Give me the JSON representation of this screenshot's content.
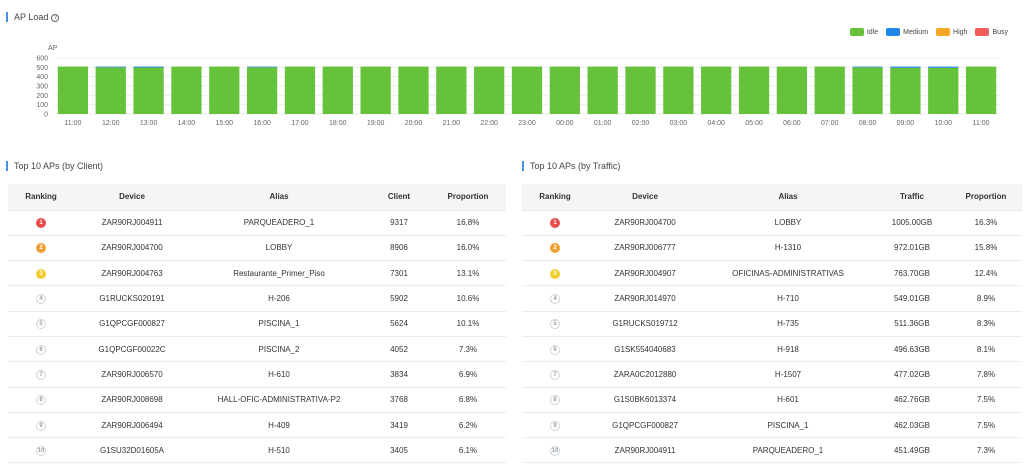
{
  "ap_load": {
    "title": "AP Load",
    "help_icon": "question-circle-icon",
    "legend": [
      {
        "label": "Idle",
        "color": "#66c23a"
      },
      {
        "label": "Medium",
        "color": "#1e88e5"
      },
      {
        "label": "High",
        "color": "#f5a623"
      },
      {
        "label": "Busy",
        "color": "#f25c5c"
      }
    ]
  },
  "chart_data": {
    "type": "bar",
    "stacked": true,
    "ylabel": "AP",
    "ylim": [
      0,
      600
    ],
    "yticks": [
      0,
      100,
      200,
      300,
      400,
      500,
      600
    ],
    "categories": [
      "11:00",
      "12:00",
      "13:00",
      "14:00",
      "15:00",
      "16:00",
      "17:00",
      "18:00",
      "19:00",
      "20:00",
      "21:00",
      "22:00",
      "23:00",
      "00:00",
      "01:00",
      "02:00",
      "03:00",
      "04:00",
      "05:00",
      "06:00",
      "07:00",
      "08:00",
      "09:00",
      "10:00",
      "11:00"
    ],
    "series": [
      {
        "name": "Idle",
        "color": "#66c23a",
        "values": [
          508,
          500,
          498,
          508,
          508,
          500,
          508,
          508,
          508,
          508,
          508,
          508,
          508,
          508,
          508,
          508,
          508,
          508,
          508,
          508,
          508,
          500,
          495,
          495,
          508
        ]
      },
      {
        "name": "Medium",
        "color": "#1e88e5",
        "values": [
          0,
          8,
          10,
          0,
          0,
          8,
          0,
          0,
          0,
          0,
          0,
          0,
          0,
          0,
          0,
          0,
          0,
          0,
          0,
          0,
          0,
          8,
          13,
          13,
          0
        ]
      },
      {
        "name": "High",
        "color": "#f5a623",
        "values": [
          0,
          0,
          0,
          0,
          0,
          0,
          0,
          0,
          0,
          0,
          0,
          0,
          0,
          0,
          0,
          0,
          0,
          0,
          0,
          0,
          0,
          0,
          0,
          0,
          0
        ]
      },
      {
        "name": "Busy",
        "color": "#f25c5c",
        "values": [
          0,
          0,
          0,
          0,
          0,
          0,
          0,
          0,
          0,
          0,
          0,
          0,
          0,
          0,
          0,
          0,
          0,
          0,
          0,
          0,
          0,
          0,
          0,
          0,
          0
        ]
      }
    ],
    "grid": true,
    "legend_position": "top-right"
  },
  "top_client": {
    "title": "Top 10 APs (by Client)",
    "headers": [
      "Ranking",
      "Device",
      "Alias",
      "Client",
      "Proportion"
    ],
    "rows": [
      {
        "rank": "1",
        "device": "ZAR90RJ004911",
        "alias": "PARQUEADERO_1",
        "value": "9317",
        "proportion": "16.8%"
      },
      {
        "rank": "2",
        "device": "ZAR90RJ004700",
        "alias": "LOBBY",
        "value": "8906",
        "proportion": "16.0%"
      },
      {
        "rank": "3",
        "device": "ZAR90RJ004763",
        "alias": "Restaurante_Primer_Piso",
        "value": "7301",
        "proportion": "13.1%"
      },
      {
        "rank": "4",
        "device": "G1RUCKS020191",
        "alias": "H-206",
        "value": "5902",
        "proportion": "10.6%"
      },
      {
        "rank": "5",
        "device": "G1QPCGF000827",
        "alias": "PISCINA_1",
        "value": "5624",
        "proportion": "10.1%"
      },
      {
        "rank": "6",
        "device": "G1QPCGF00022C",
        "alias": "PISCINA_2",
        "value": "4052",
        "proportion": "7.3%"
      },
      {
        "rank": "7",
        "device": "ZAR90RJ006570",
        "alias": "H-610",
        "value": "3834",
        "proportion": "6.9%"
      },
      {
        "rank": "8",
        "device": "ZAR90RJ008698",
        "alias": "HALL-OFIC-ADMINISTRATIVA-P2",
        "value": "3768",
        "proportion": "6.8%"
      },
      {
        "rank": "9",
        "device": "ZAR90RJ006494",
        "alias": "H-409",
        "value": "3419",
        "proportion": "6.2%"
      },
      {
        "rank": "10",
        "device": "G1SU32D01605A",
        "alias": "H-510",
        "value": "3405",
        "proportion": "6.1%"
      }
    ]
  },
  "top_traffic": {
    "title": "Top 10 APs (by Traffic)",
    "headers": [
      "Ranking",
      "Device",
      "Alias",
      "Traffic",
      "Proportion"
    ],
    "rows": [
      {
        "rank": "1",
        "device": "ZAR90RJ004700",
        "alias": "LOBBY",
        "value": "1005.00GB",
        "proportion": "16.3%"
      },
      {
        "rank": "2",
        "device": "ZAR90RJ006777",
        "alias": "H-1310",
        "value": "972.01GB",
        "proportion": "15.8%"
      },
      {
        "rank": "3",
        "device": "ZAR90RJ004907",
        "alias": "OFICINAS-ADMINISTRATIVAS",
        "value": "763.70GB",
        "proportion": "12.4%"
      },
      {
        "rank": "4",
        "device": "ZAR90RJ014970",
        "alias": "H-710",
        "value": "549.01GB",
        "proportion": "8.9%"
      },
      {
        "rank": "5",
        "device": "G1RUCKS019712",
        "alias": "H-735",
        "value": "511.36GB",
        "proportion": "8.3%"
      },
      {
        "rank": "6",
        "device": "G1SK554040683",
        "alias": "H-918",
        "value": "496.63GB",
        "proportion": "8.1%"
      },
      {
        "rank": "7",
        "device": "ZARA0C2012880",
        "alias": "H-1507",
        "value": "477.02GB",
        "proportion": "7.8%"
      },
      {
        "rank": "8",
        "device": "G1S0BK6013374",
        "alias": "H-601",
        "value": "462.76GB",
        "proportion": "7.5%"
      },
      {
        "rank": "9",
        "device": "G1QPCGF000827",
        "alias": "PISCINA_1",
        "value": "462.03GB",
        "proportion": "7.5%"
      },
      {
        "rank": "10",
        "device": "ZAR90RJ004911",
        "alias": "PARQUEADERO_1",
        "value": "451.49GB",
        "proportion": "7.3%"
      }
    ]
  }
}
